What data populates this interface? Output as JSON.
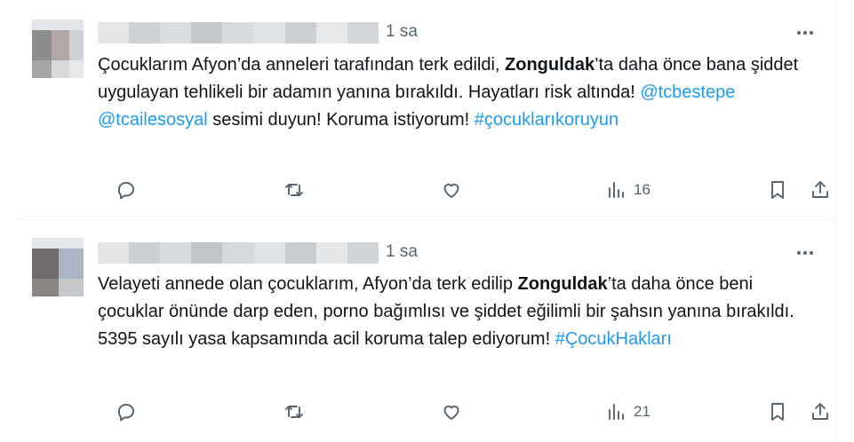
{
  "tweets": [
    {
      "time": "1 sa",
      "segments": [
        {
          "type": "text",
          "value": "Çocuklarım Afyon’da anneleri tarafından terk edildi, "
        },
        {
          "type": "bold",
          "value": "Zonguldak"
        },
        {
          "type": "text",
          "value": "’ta daha önce bana şiddet uygulayan tehlikeli bir adamın yanına bırakıldı. Hayatları risk altında! "
        },
        {
          "type": "link",
          "value": "@tcbestepe"
        },
        {
          "type": "text",
          "value": " "
        },
        {
          "type": "link",
          "value": "@tcailesosyal"
        },
        {
          "type": "text",
          "value": " sesimi duyun! Koruma istiyorum! "
        },
        {
          "type": "link",
          "value": "#çocuklarıkoruyun"
        }
      ],
      "views": "16"
    },
    {
      "time": "1 sa",
      "segments": [
        {
          "type": "text",
          "value": "Velayeti annede olan çocuklarım, Afyon’da terk edilip "
        },
        {
          "type": "bold",
          "value": "Zonguldak"
        },
        {
          "type": "text",
          "value": "’ta daha önce beni çocuklar önünde darp eden, porno bağımlısı ve şiddet eğilimli bir şahsın yanına bırakıldı. 5395 sayılı yasa kapsamında acil koruma talep ediyorum! "
        },
        {
          "type": "link",
          "value": "#ÇocukHakları"
        }
      ],
      "views": "21"
    }
  ],
  "icons": {
    "reply": "reply-icon",
    "retweet": "retweet-icon",
    "like": "heart-icon",
    "views": "views-icon",
    "bookmark": "bookmark-icon",
    "share": "share-icon",
    "more": "more-icon"
  },
  "colors": {
    "link": "#1d9bf0",
    "text": "#0f1419",
    "secondary": "#536471",
    "divider": "#eff3f4"
  }
}
